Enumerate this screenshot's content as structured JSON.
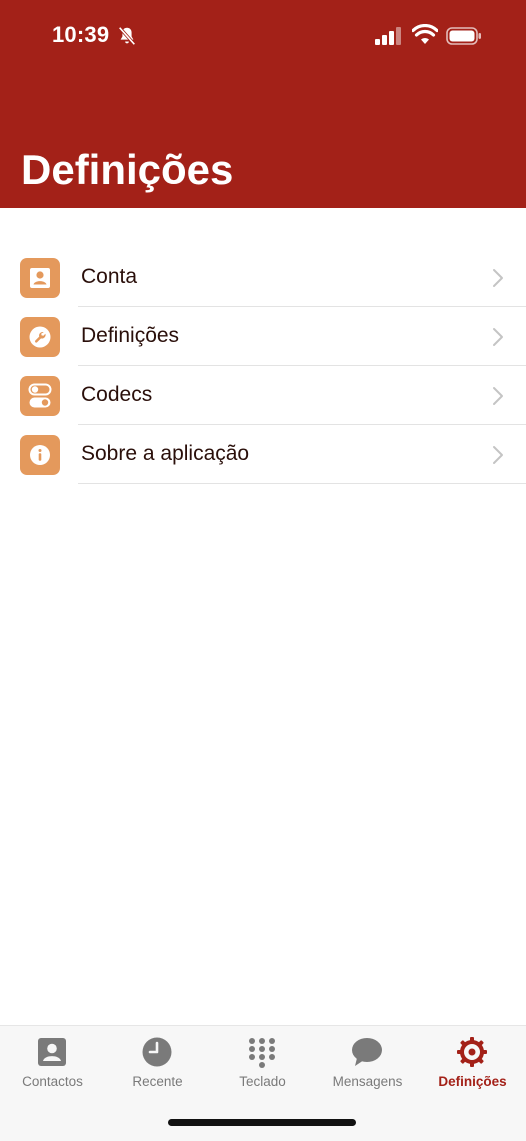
{
  "status_bar": {
    "time": "10:39"
  },
  "header": {
    "title": "Definições"
  },
  "settings_list": {
    "items": [
      {
        "label": "Conta",
        "icon": "person-icon"
      },
      {
        "label": "Definições",
        "icon": "wrench-icon"
      },
      {
        "label": "Codecs",
        "icon": "toggles-icon"
      },
      {
        "label": "Sobre a aplicação",
        "icon": "info-icon"
      }
    ]
  },
  "tab_bar": {
    "tabs": [
      {
        "label": "Contactos",
        "icon": "contact-card-icon"
      },
      {
        "label": "Recente",
        "icon": "clock-icon"
      },
      {
        "label": "Teclado",
        "icon": "keypad-icon"
      },
      {
        "label": "Mensagens",
        "icon": "chat-bubble-icon"
      },
      {
        "label": "Definições",
        "icon": "gear-icon"
      }
    ],
    "active_index": 4
  },
  "colors": {
    "brand": "#a32118",
    "icon_bg": "#e4995c",
    "inactive_tab": "#7a7a7a"
  }
}
